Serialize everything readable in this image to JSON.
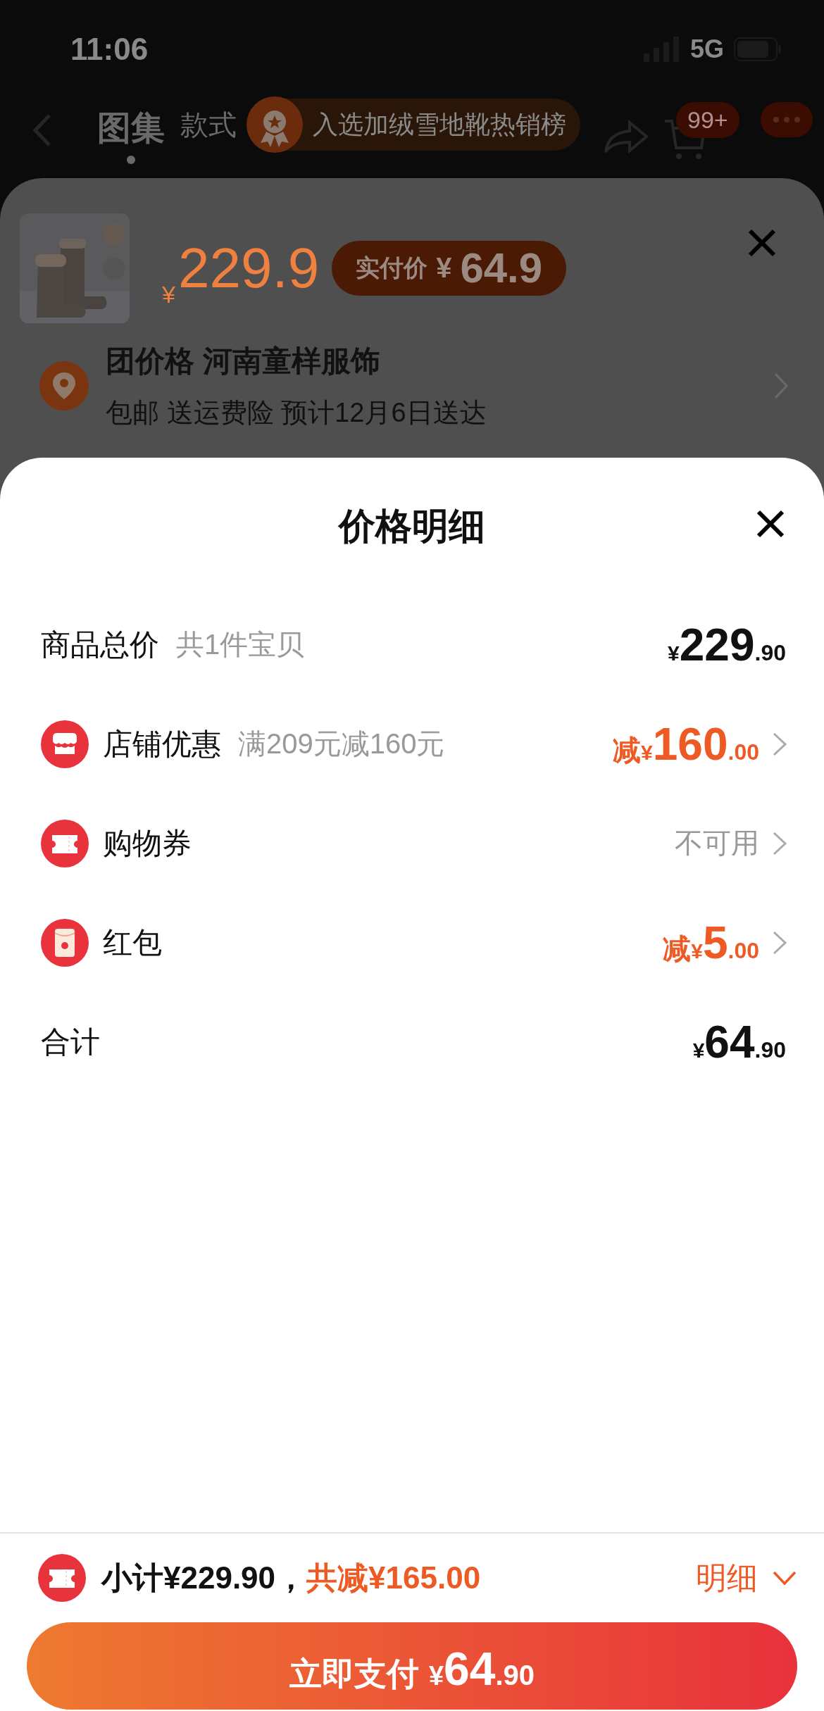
{
  "status_bar": {
    "time": "11:06",
    "network": "5G"
  },
  "header": {
    "tabs": [
      {
        "label": "图集",
        "selected": true
      },
      {
        "label": "款式",
        "selected": false
      }
    ],
    "cart_badge": "99+",
    "banner": "入选加绒雪地靴热销榜"
  },
  "product_sheet": {
    "currency": "¥",
    "price": "229.9",
    "actual_label": "实付价",
    "actual_currency": "¥",
    "actual_price": "64.9",
    "address_title": "团价格 河南童样服饰",
    "address_detail": "包邮 送运费险 预计12月6日送达"
  },
  "price_detail": {
    "title": "价格明细",
    "rows": [
      {
        "kind": "amount",
        "label": "商品总价",
        "note": "共1件宝贝",
        "currency": "¥",
        "integer": "229",
        "decimal": ".90"
      },
      {
        "kind": "discount",
        "label": "店铺优惠",
        "note": "满209元减160元",
        "prefix": "减",
        "currency": "¥",
        "integer": "160",
        "decimal": ".00"
      },
      {
        "kind": "status",
        "label": "购物券",
        "status": "不可用"
      },
      {
        "kind": "discount",
        "label": "红包",
        "prefix": "减",
        "currency": "¥",
        "integer": "5",
        "decimal": ".00"
      },
      {
        "kind": "amount",
        "label": "合计",
        "currency": "¥",
        "integer": "64",
        "decimal": ".90"
      }
    ]
  },
  "footer": {
    "subtotal": "小计¥229.90，",
    "savings": "共减¥165.00",
    "detail_link": "明细",
    "pay_label": "立即支付",
    "pay_currency": "¥",
    "pay_integer": "64",
    "pay_decimal": ".90"
  }
}
